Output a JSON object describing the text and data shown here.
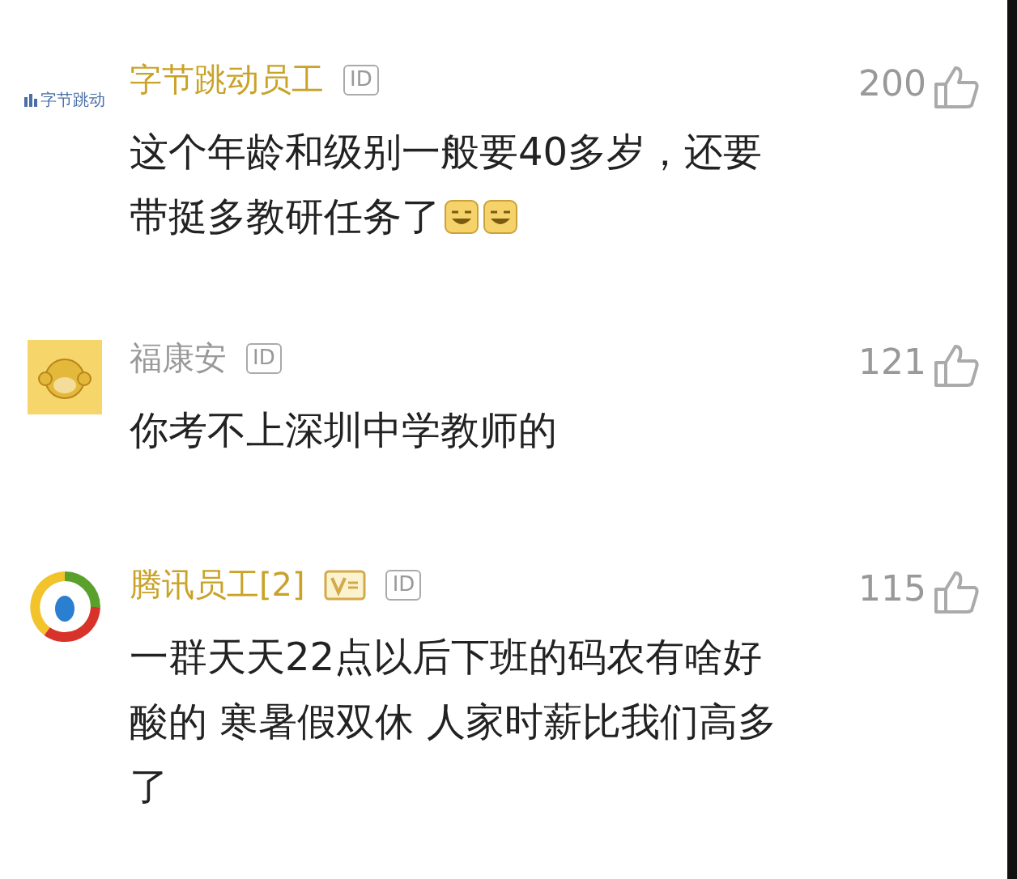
{
  "comments": [
    {
      "avatar": {
        "kind": "logo",
        "text": "字节跳动"
      },
      "name": "字节跳动员工",
      "color": "#c9a227",
      "badges": [
        {
          "kind": "id",
          "label": "ID"
        }
      ],
      "text": "这个年龄和级别一般要40多岁，还要带挺多教研任务了",
      "stickers": [
        {
          "kind": "grin"
        },
        {
          "kind": "grin"
        }
      ],
      "likes": "200"
    },
    {
      "avatar": {
        "kind": "monkey"
      },
      "name": "福康安",
      "color": "#999999",
      "badges": [
        {
          "kind": "id",
          "label": "ID"
        }
      ],
      "text": "你考不上深圳中学教师的",
      "likes": "121"
    },
    {
      "avatar": {
        "kind": "ring"
      },
      "name": "腾讯员工[2]",
      "color": "#c9a227",
      "badges": [
        {
          "kind": "v"
        },
        {
          "kind": "id",
          "label": "ID"
        }
      ],
      "text": "一群天天22点以后下班的码农有啥好酸的 寒暑假双休 人家时薪比我们高多了",
      "likes": "115"
    }
  ]
}
